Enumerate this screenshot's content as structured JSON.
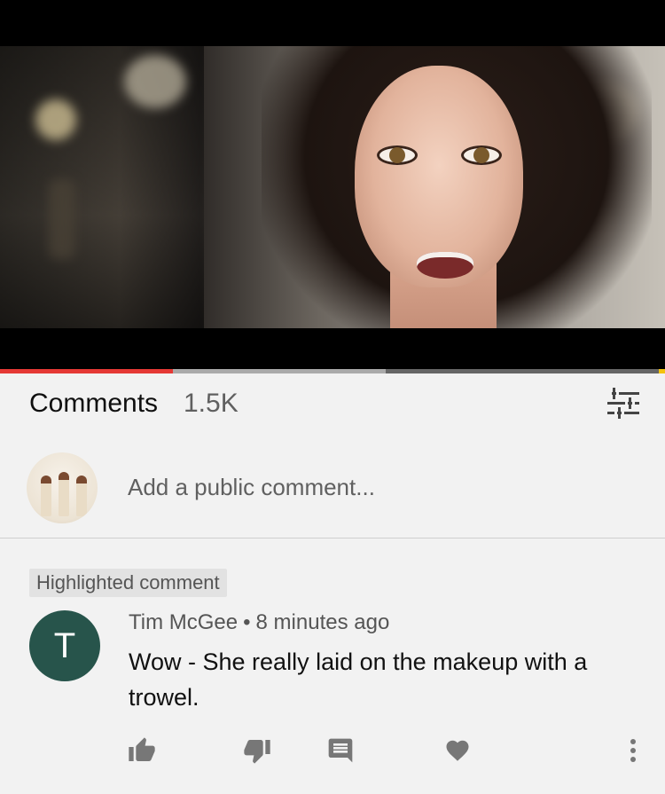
{
  "video": {
    "progress_played": 0.26,
    "progress_buffered": 0.58,
    "colors": {
      "played": "#e53935",
      "buffered": "#aaaaaa",
      "track": "#666666",
      "marker": "#f4c20d"
    }
  },
  "comments_header": {
    "title": "Comments",
    "count": "1.5K",
    "filter_icon": "sort-filter-icon"
  },
  "add_comment": {
    "placeholder": "Add a public comment..."
  },
  "highlighted": {
    "badge": "Highlighted comment",
    "avatar_letter": "T",
    "author": "Tim McGee",
    "separator": "•",
    "time": "8 minutes ago",
    "text": "Wow - She really laid on the makeup with a trowel.",
    "avatar_color": "#27544b"
  },
  "actions": [
    {
      "name": "like-icon"
    },
    {
      "name": "dislike-icon"
    },
    {
      "name": "reply-icon"
    },
    {
      "name": "heart-icon"
    },
    {
      "name": "more-options-icon"
    }
  ]
}
